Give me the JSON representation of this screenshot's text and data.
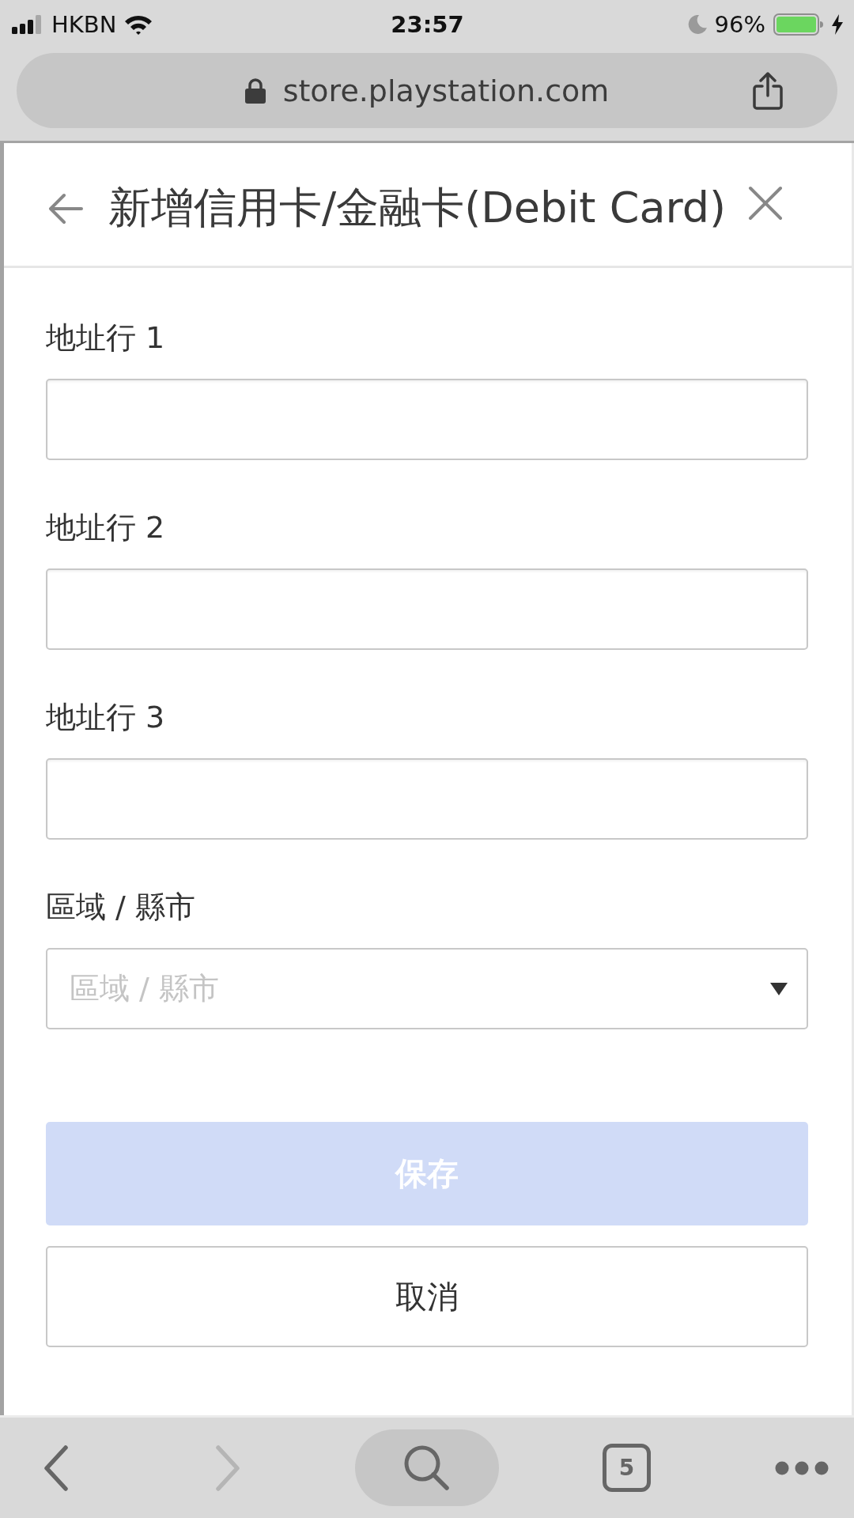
{
  "status_bar": {
    "carrier": "HKBN",
    "time": "23:57",
    "do_not_disturb": true,
    "battery": "96%",
    "charging": true
  },
  "browser": {
    "url": "store.playstation.com"
  },
  "dialog": {
    "title": "新增信用卡/金融卡(Debit Card)"
  },
  "form": {
    "fields": [
      {
        "kind": "text",
        "label": "地址行 1"
      },
      {
        "kind": "text",
        "label": "地址行 2"
      },
      {
        "kind": "text",
        "label": "地址行 3"
      },
      {
        "kind": "select",
        "label": "區域 / 縣市",
        "placeholder": "區域 / 縣市"
      }
    ]
  },
  "buttons": [
    {
      "kind": "primary",
      "label": "保存",
      "disabled": true
    },
    {
      "kind": "secondary",
      "label": "取消",
      "disabled": false
    }
  ],
  "toolbar": {
    "items": [
      {
        "kind": "back",
        "disabled": false
      },
      {
        "kind": "forward",
        "disabled": true
      },
      {
        "kind": "search"
      },
      {
        "kind": "tabs",
        "count": "5"
      },
      {
        "kind": "more"
      }
    ]
  }
}
